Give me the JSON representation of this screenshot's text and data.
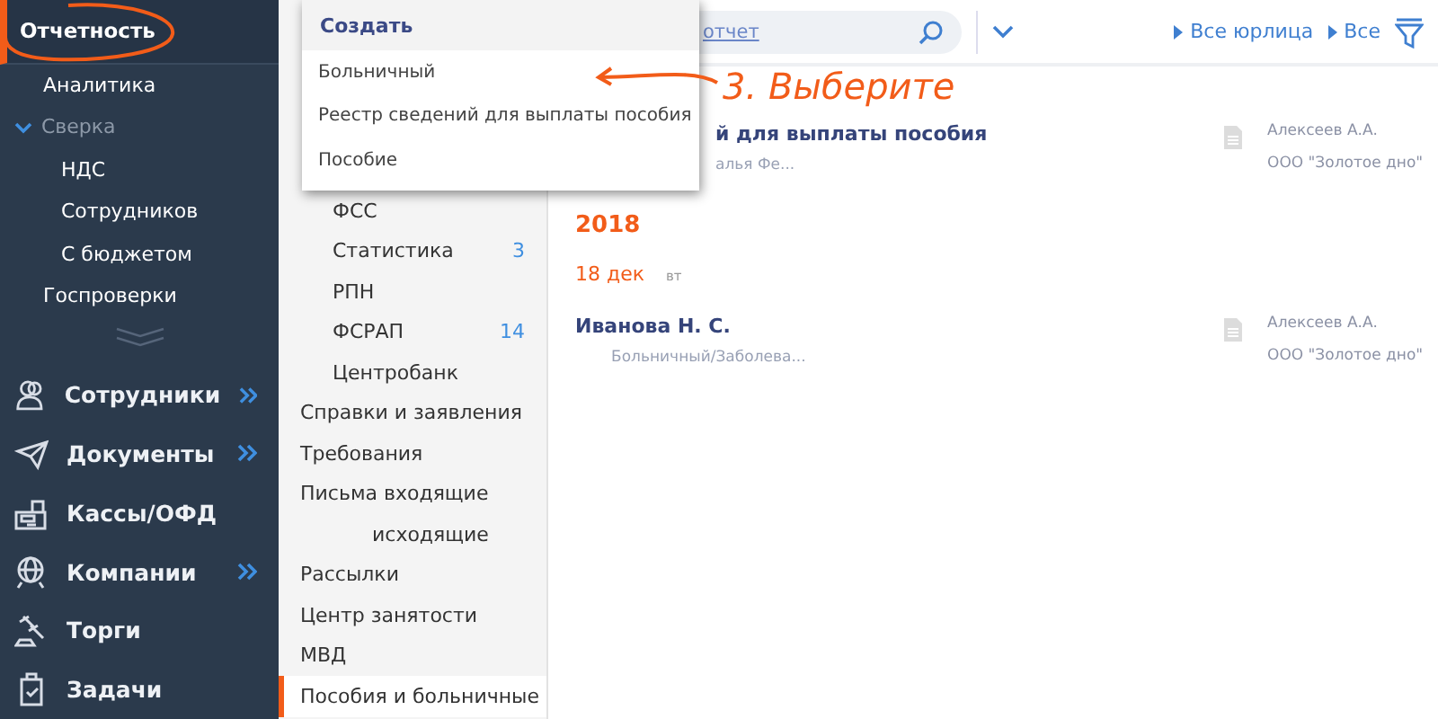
{
  "sidebar": {
    "section": {
      "label": "Отчетность",
      "selected": true
    },
    "items": [
      {
        "label": "Аналитика"
      },
      {
        "label": "Сверка",
        "expanded": true,
        "children": [
          {
            "label": "НДС"
          },
          {
            "label": "Сотрудников"
          },
          {
            "label": "С бюджетом"
          }
        ]
      },
      {
        "label": "Госпроверки"
      }
    ],
    "modules": [
      {
        "label": "Сотрудники",
        "kind": "people",
        "has_submenu": true
      },
      {
        "label": "Документы",
        "kind": "plane",
        "has_submenu": true
      },
      {
        "label": "Кассы/ОФД",
        "kind": "register",
        "has_submenu": false
      },
      {
        "label": "Компании",
        "kind": "globe",
        "has_submenu": true
      },
      {
        "label": "Торги",
        "kind": "gavel",
        "has_submenu": false
      },
      {
        "label": "Задачи",
        "kind": "clipboard",
        "has_submenu": false
      }
    ]
  },
  "subnav": [
    {
      "kind": "group",
      "children": [
        {
          "label": "ФСС",
          "selected": false
        },
        {
          "label": "Статистика",
          "count": "3",
          "selected": false
        },
        {
          "label": "РПН",
          "selected": false
        },
        {
          "label": "ФСРАП",
          "count": "14",
          "selected": false
        },
        {
          "label": "Центробанк",
          "selected": false
        }
      ]
    },
    {
      "label": "Справки и заявления",
      "selected": false
    },
    {
      "label": "Требования",
      "selected": false
    },
    {
      "label": "Письма входящие",
      "selected": false,
      "children": [
        {
          "label": "исходящие",
          "selected": false
        }
      ]
    },
    {
      "label": "Рассылки",
      "selected": false
    },
    {
      "label": "Центр занятости",
      "selected": false
    },
    {
      "label": "МВД",
      "selected": false
    },
    {
      "label": "Пособия и больничные",
      "selected": true
    }
  ],
  "toolbar": {
    "search": {
      "value": "отчет"
    },
    "filters": [
      "Все юрлица",
      "Все"
    ]
  },
  "feed": [
    {
      "kind": "entry",
      "title": "й для выплаты пособия",
      "subtitle": "алья Фе...",
      "author": "Алексеев А.А.",
      "company": "ООО \"Золотое дно\""
    },
    {
      "kind": "year",
      "text": "2018"
    },
    {
      "kind": "date",
      "day": "18 дек",
      "weekday": "вт"
    },
    {
      "kind": "entry",
      "title": "Иванова Н. С.",
      "subtitle": "Больничный/Заболева...",
      "author": "Алексеев А.А.",
      "company": "ООО \"Золотое дно\""
    }
  ],
  "dropdown": {
    "title": "Создать",
    "items": [
      "Больничный",
      "Реестр сведений для выплаты пособия",
      "Пособие"
    ]
  },
  "annotation": {
    "text": "3. Выберите"
  }
}
